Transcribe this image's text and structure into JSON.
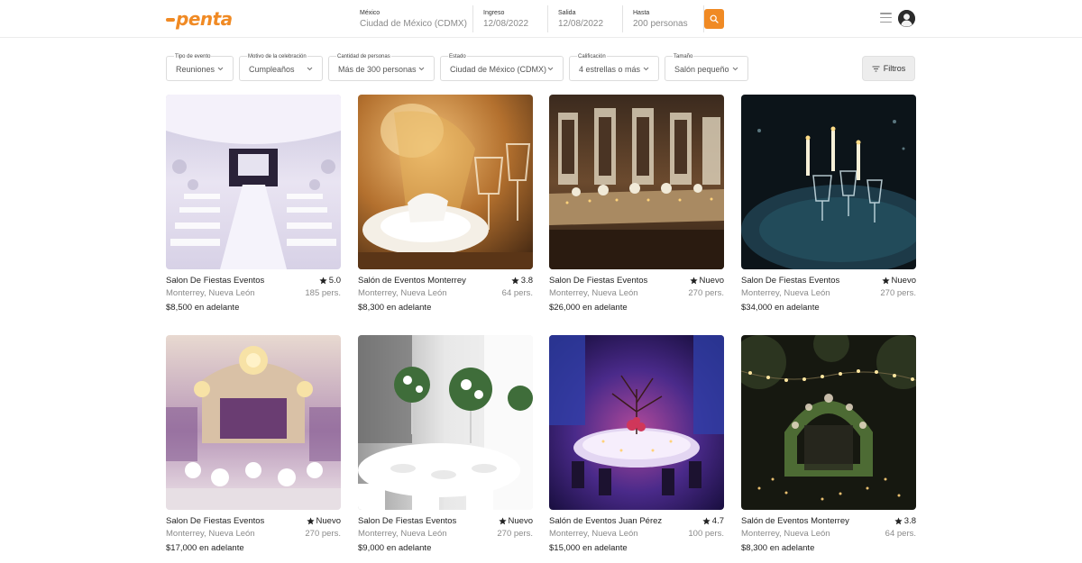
{
  "header": {
    "logo_text": "penta",
    "location_label": "México",
    "location_value": "Ciudad de México (CDMX)",
    "ingreso_label": "Ingreso",
    "ingreso_value": "12/08/2022",
    "salida_label": "Salida",
    "salida_value": "12/08/2022",
    "hasta_label": "Hasta",
    "hasta_value": "200 personas",
    "search_icon": "search-icon",
    "menu_icon": "hamburger-menu-icon",
    "avatar_icon": "user-avatar-icon"
  },
  "filters": [
    {
      "label": "Tipo de evento",
      "value": "Reuniones"
    },
    {
      "label": "Motivo de la celebración",
      "value": "Cumpleaños"
    },
    {
      "label": "Cantidad de personas",
      "value": "Más de 300 personas"
    },
    {
      "label": "Estado",
      "value": "Ciudad de México (CDMX)"
    },
    {
      "label": "Calificación",
      "value": "4 estrellas o más"
    },
    {
      "label": "Tamaño",
      "value": "Salón pequeño"
    }
  ],
  "filtros_button": {
    "label": "Filtros",
    "icon": "filter-icon"
  },
  "cards": [
    {
      "title": "Salon De Fiestas Eventos",
      "rating": "5.0",
      "location": "Monterrey, Nueva León",
      "capacity": "185 pers.",
      "price": "$8,500 en adelante"
    },
    {
      "title": "Salón de Eventos Monterrey",
      "rating": "3.8",
      "location": "Monterrey, Nueva León",
      "capacity": "64 pers.",
      "price": "$8,300 en adelante"
    },
    {
      "title": "Salon De Fiestas Eventos",
      "rating": "Nuevo",
      "location": "Monterrey, Nueva León",
      "capacity": "270 pers.",
      "price": "$26,000 en adelante"
    },
    {
      "title": "Salon De Fiestas Eventos",
      "rating": "Nuevo",
      "location": "Monterrey, Nueva León",
      "capacity": "270 pers.",
      "price": "$34,000 en adelante"
    },
    {
      "title": "Salon De Fiestas Eventos",
      "rating": "Nuevo",
      "location": "Monterrey, Nueva León",
      "capacity": "270 pers.",
      "price": "$17,000 en adelante"
    },
    {
      "title": "Salon De Fiestas Eventos",
      "rating": "Nuevo",
      "location": "Monterrey, Nueva León",
      "capacity": "270 pers.",
      "price": "$9,000 en adelante"
    },
    {
      "title": "Salón de Eventos Juan Pérez",
      "rating": "4.7",
      "location": "Monterrey, Nueva León",
      "capacity": "100 pers.",
      "price": "$15,000 en adelante"
    },
    {
      "title": "Salón de Eventos Monterrey",
      "rating": "3.8",
      "location": "Monterrey, Nueva León",
      "capacity": "64 pers.",
      "price": "$8,300 en adelante"
    }
  ],
  "colors": {
    "brand": "#f08a24",
    "text": "#222222",
    "muted": "#8a8a8a"
  }
}
